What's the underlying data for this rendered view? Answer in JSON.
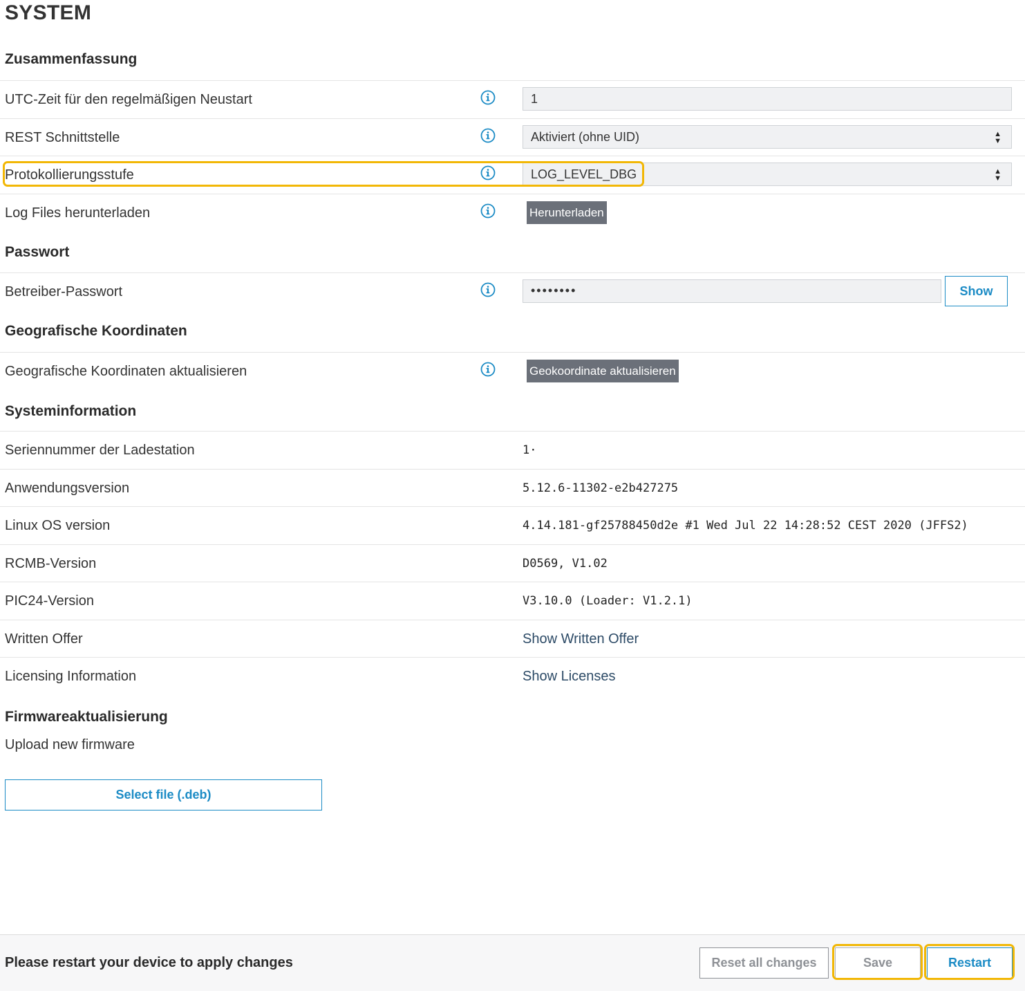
{
  "page_title": "SYSTEM",
  "sections": {
    "summary": "Zusammenfassung",
    "password": "Passwort",
    "geo": "Geografische Koordinaten",
    "sysinfo": "Systeminformation",
    "firmware": "Firmwareaktualisierung"
  },
  "summary": {
    "utc_restart": {
      "label": "UTC-Zeit für den regelmäßigen Neustart",
      "value": "1"
    },
    "rest": {
      "label": "REST Schnittstelle",
      "value": "Aktiviert (ohne UID)"
    },
    "log_level": {
      "label": "Protokollierungsstufe",
      "value": "LOG_LEVEL_DBG"
    },
    "log_files": {
      "label": "Log Files herunterladen",
      "button": "Herunterladen"
    }
  },
  "password": {
    "label": "Betreiber-Passwort",
    "value": "••••••••",
    "show_button": "Show"
  },
  "geo": {
    "label": "Geografische Koordinaten aktualisieren",
    "button": "Geokoordinate aktualisieren"
  },
  "sysinfo": {
    "serial": {
      "label": "Seriennummer der Ladestation",
      "value": "1·"
    },
    "app_version": {
      "label": "Anwendungsversion",
      "value": "5.12.6-11302-e2b427275"
    },
    "linux": {
      "label": "Linux OS version",
      "value": "4.14.181-gf25788450d2e #1 Wed Jul 22 14:28:52 CEST 2020 (JFFS2)"
    },
    "rcmb": {
      "label": "RCMB-Version",
      "value": "D0569, V1.02"
    },
    "pic24": {
      "label": "PIC24-Version",
      "value": "V3.10.0 (Loader: V1.2.1)"
    },
    "written_offer": {
      "label": "Written Offer",
      "link": "Show Written Offer"
    },
    "licensing": {
      "label": "Licensing Information",
      "link": "Show Licenses"
    }
  },
  "firmware": {
    "upload_label": "Upload new firmware",
    "select_button": "Select file (.deb)"
  },
  "footer": {
    "message": "Please restart your device to apply changes",
    "reset": "Reset all changes",
    "save": "Save",
    "restart": "Restart"
  },
  "colors": {
    "accent": "#1b8bc5",
    "highlight": "#f2b705",
    "gray_button": "#6b7079"
  },
  "icons": {
    "info": "info-circle-icon",
    "select_arrows": "sort-arrows-icon"
  }
}
